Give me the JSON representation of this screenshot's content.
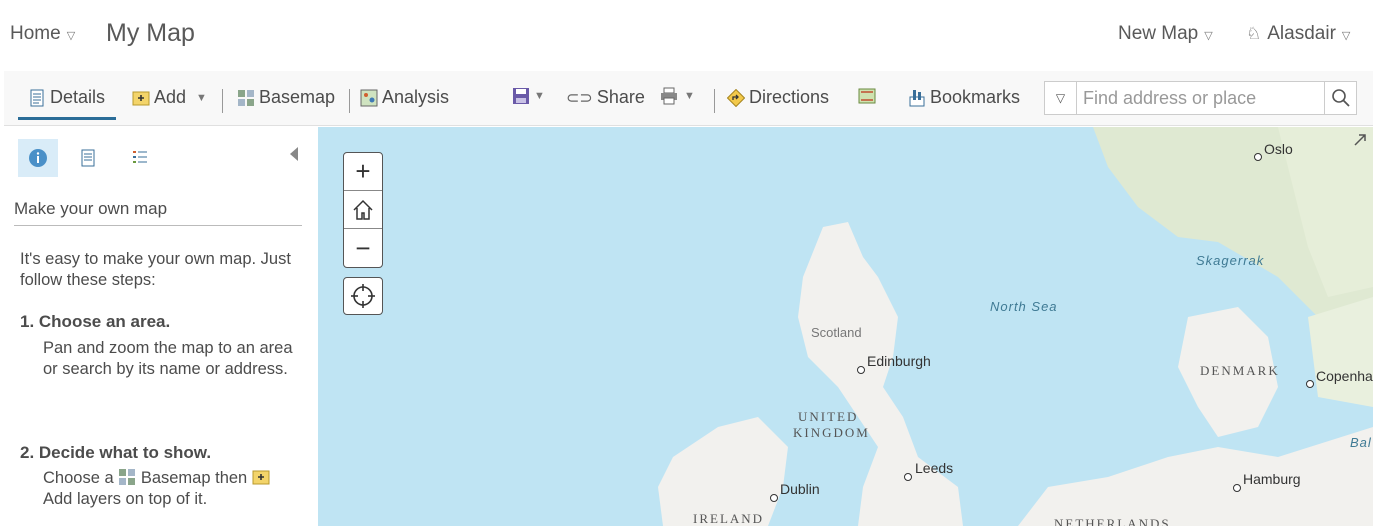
{
  "header": {
    "home_label": "Home",
    "map_title": "My Map",
    "new_map_label": "New Map",
    "user_name": "Alasdair"
  },
  "toolbar": {
    "details": "Details",
    "add": "Add",
    "basemap": "Basemap",
    "analysis": "Analysis",
    "share": "Share",
    "directions": "Directions",
    "bookmarks": "Bookmarks",
    "search_placeholder": "Find address or place",
    "search_value": ""
  },
  "sidebar": {
    "heading": "Make your own map",
    "intro": "It's easy to make your own map. Just follow these steps:",
    "steps": [
      {
        "title": "1. Choose an area.",
        "body": "Pan and zoom the map to an area or search by its name or address."
      },
      {
        "title": "2. Decide what to show.",
        "body_a": "Choose a",
        "body_b": "Basemap then",
        "body_c": "Add layers on top of it."
      }
    ]
  },
  "map": {
    "labels": {
      "oslo": "Oslo",
      "skagerrak": "Skagerrak",
      "north_sea": "North Sea",
      "scotland": "Scotland",
      "edinburgh": "Edinburgh",
      "denmark": "DENMARK",
      "copenhagen": "Copenha",
      "united": "UNITED",
      "kingdom": "KINGDOM",
      "baltic": "Bal",
      "leeds": "Leeds",
      "hamburg": "Hamburg",
      "dublin": "Dublin",
      "ireland": "IRELAND",
      "netherlands": "NETHERLANDS"
    },
    "colors": {
      "water": "#bfe4f3",
      "land": "#f2f1ee",
      "forest": "#dfe9d2"
    }
  }
}
